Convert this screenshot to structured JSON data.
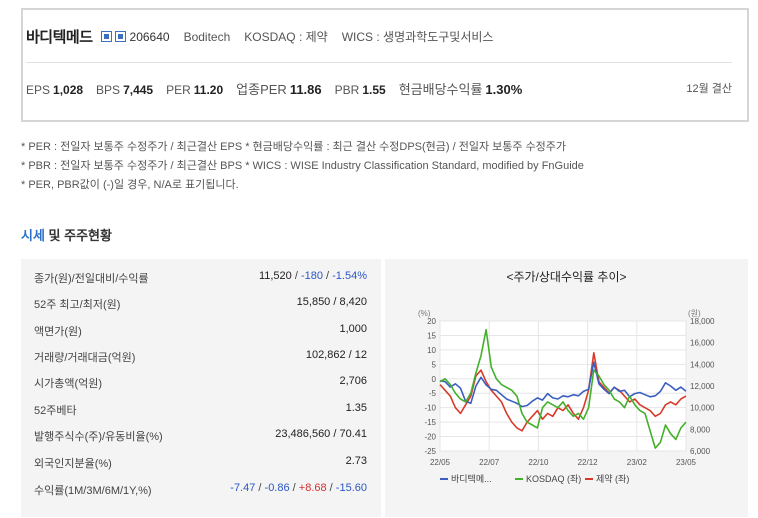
{
  "company": {
    "name": "바디텍메드",
    "code": "206640",
    "english_name": "Boditech",
    "market": "KOSDAQ : 제약",
    "wics": "WICS : 생명과학도구및서비스"
  },
  "metrics": [
    {
      "label": "EPS",
      "value": "1,028"
    },
    {
      "label": "BPS",
      "value": "7,445"
    },
    {
      "label": "PER",
      "value": "11.20"
    },
    {
      "label": "업종PER",
      "value": "11.86"
    },
    {
      "label": "PBR",
      "value": "1.55"
    },
    {
      "label": "현금배당수익률",
      "value": "1.30%"
    }
  ],
  "settlement": "12월 결산",
  "footnotes": [
    "* PER : 전일자 보통주 수정주가 / 최근결산 EPS * 현금배당수익률 : 최근 결산 수정DPS(현금) / 전일자 보통주 수정주가",
    "* PBR : 전일자 보통주 수정주가 / 최근결산 BPS * WICS : WISE Industry Classification Standard, modified by FnGuide",
    "* PER, PBR값이 (-)일 경우, N/A로 표기됩니다."
  ],
  "section": {
    "title_highlight": "시세",
    "title_rest": " 및 주주현황"
  },
  "stats": [
    {
      "label": "종가(원)/전일대비/수익률",
      "parts": [
        {
          "t": "11,520",
          "c": ""
        },
        {
          "t": " / ",
          "c": "sep"
        },
        {
          "t": "-180",
          "c": "neg"
        },
        {
          "t": " / ",
          "c": "sep"
        },
        {
          "t": "-1.54%",
          "c": "neg"
        }
      ]
    },
    {
      "label": "52주 최고/최저(원)",
      "parts": [
        {
          "t": "15,850 / 8,420",
          "c": ""
        }
      ]
    },
    {
      "label": "액면가(원)",
      "parts": [
        {
          "t": "1,000",
          "c": ""
        }
      ]
    },
    {
      "label": "거래량/거래대금(억원)",
      "parts": [
        {
          "t": "102,862 / 12",
          "c": ""
        }
      ]
    },
    {
      "label": "시가총액(억원)",
      "parts": [
        {
          "t": "2,706",
          "c": ""
        }
      ]
    },
    {
      "label": "52주베타",
      "parts": [
        {
          "t": "1.35",
          "c": ""
        }
      ]
    },
    {
      "label": "발행주식수(주)/유동비율(%)",
      "parts": [
        {
          "t": "23,486,560 / 70.41",
          "c": ""
        }
      ]
    },
    {
      "label": "외국인지분율(%)",
      "parts": [
        {
          "t": "2.73",
          "c": ""
        }
      ]
    },
    {
      "label": "수익률(1M/3M/6M/1Y,%)",
      "parts": [
        {
          "t": "-7.47",
          "c": "neg"
        },
        {
          "t": " / ",
          "c": "sep"
        },
        {
          "t": "-0.86",
          "c": "neg"
        },
        {
          "t": " / ",
          "c": "sep"
        },
        {
          "t": "+8.68",
          "c": "pos"
        },
        {
          "t": " / ",
          "c": "sep"
        },
        {
          "t": "-15.60",
          "c": "neg"
        }
      ]
    }
  ],
  "chart_data": {
    "type": "line",
    "title": "<주가/상대수익률 추이>",
    "left_unit": "(%)",
    "right_unit": "(원)",
    "left_ylim": [
      -25,
      20
    ],
    "left_ticks": [
      20,
      15,
      10,
      5,
      0,
      -5,
      -10,
      -15,
      -20,
      -25
    ],
    "right_ylim": [
      6000,
      18000
    ],
    "right_ticks": [
      "18,000",
      "16,000",
      "14,000",
      "12,000",
      "10,000",
      "8,000",
      "6,000"
    ],
    "x_ticks": [
      "22/05",
      "22/07",
      "22/10",
      "22/12",
      "23/02",
      "23/05"
    ],
    "grid": true,
    "legend_position": "bottom",
    "series": [
      {
        "name": "바디텍메...",
        "color": "#3a5fc0",
        "axis": "right",
        "values": [
          12500,
          12400,
          11900,
          12200,
          11800,
          10600,
          10400,
          12000,
          12800,
          12100,
          11700,
          11600,
          11200,
          10800,
          10600,
          10400,
          10100,
          10200,
          10600,
          10900,
          10700,
          11300,
          10900,
          10800,
          11100,
          11000,
          11200,
          11100,
          11500,
          11700,
          14200,
          12200,
          11700,
          11300,
          11900,
          11500,
          11600,
          11000,
          11300,
          11400,
          11200,
          11000,
          11100,
          11500,
          12300,
          12000,
          11600,
          11900,
          11520
        ]
      },
      {
        "name": "KOSDAQ (좌)",
        "color": "#43b02a",
        "axis": "left",
        "values": [
          -1,
          0,
          -2,
          -5,
          -7,
          -8,
          -5,
          2,
          8,
          17,
          4,
          0,
          -2,
          -3,
          -4,
          -6,
          -12,
          -15,
          -16,
          -17,
          -10,
          -8,
          -9,
          -10,
          -8,
          -11,
          -13,
          -12,
          -14,
          -10,
          3,
          1,
          -2,
          -4,
          -7,
          -8,
          -10,
          -6,
          -9,
          -11,
          -12,
          -18,
          -24,
          -22,
          -16,
          -19,
          -21,
          -17,
          -15
        ]
      },
      {
        "name": "제약 (좌)",
        "color": "#d83a2a",
        "axis": "left",
        "values": [
          -2,
          -4,
          -6,
          -10,
          -12,
          -9,
          -6,
          1,
          3,
          -1,
          -4,
          -6,
          -8,
          -12,
          -15,
          -17,
          -18,
          -15,
          -13,
          -11,
          -14,
          -12,
          -13,
          -10,
          -11,
          -9,
          -12,
          -14,
          -10,
          -4,
          9,
          -1,
          -3,
          -5,
          -3,
          -4,
          -6,
          -8,
          -7,
          -9,
          -10,
          -11,
          -13,
          -12,
          -9,
          -8,
          -9,
          -7,
          -6
        ]
      }
    ]
  }
}
